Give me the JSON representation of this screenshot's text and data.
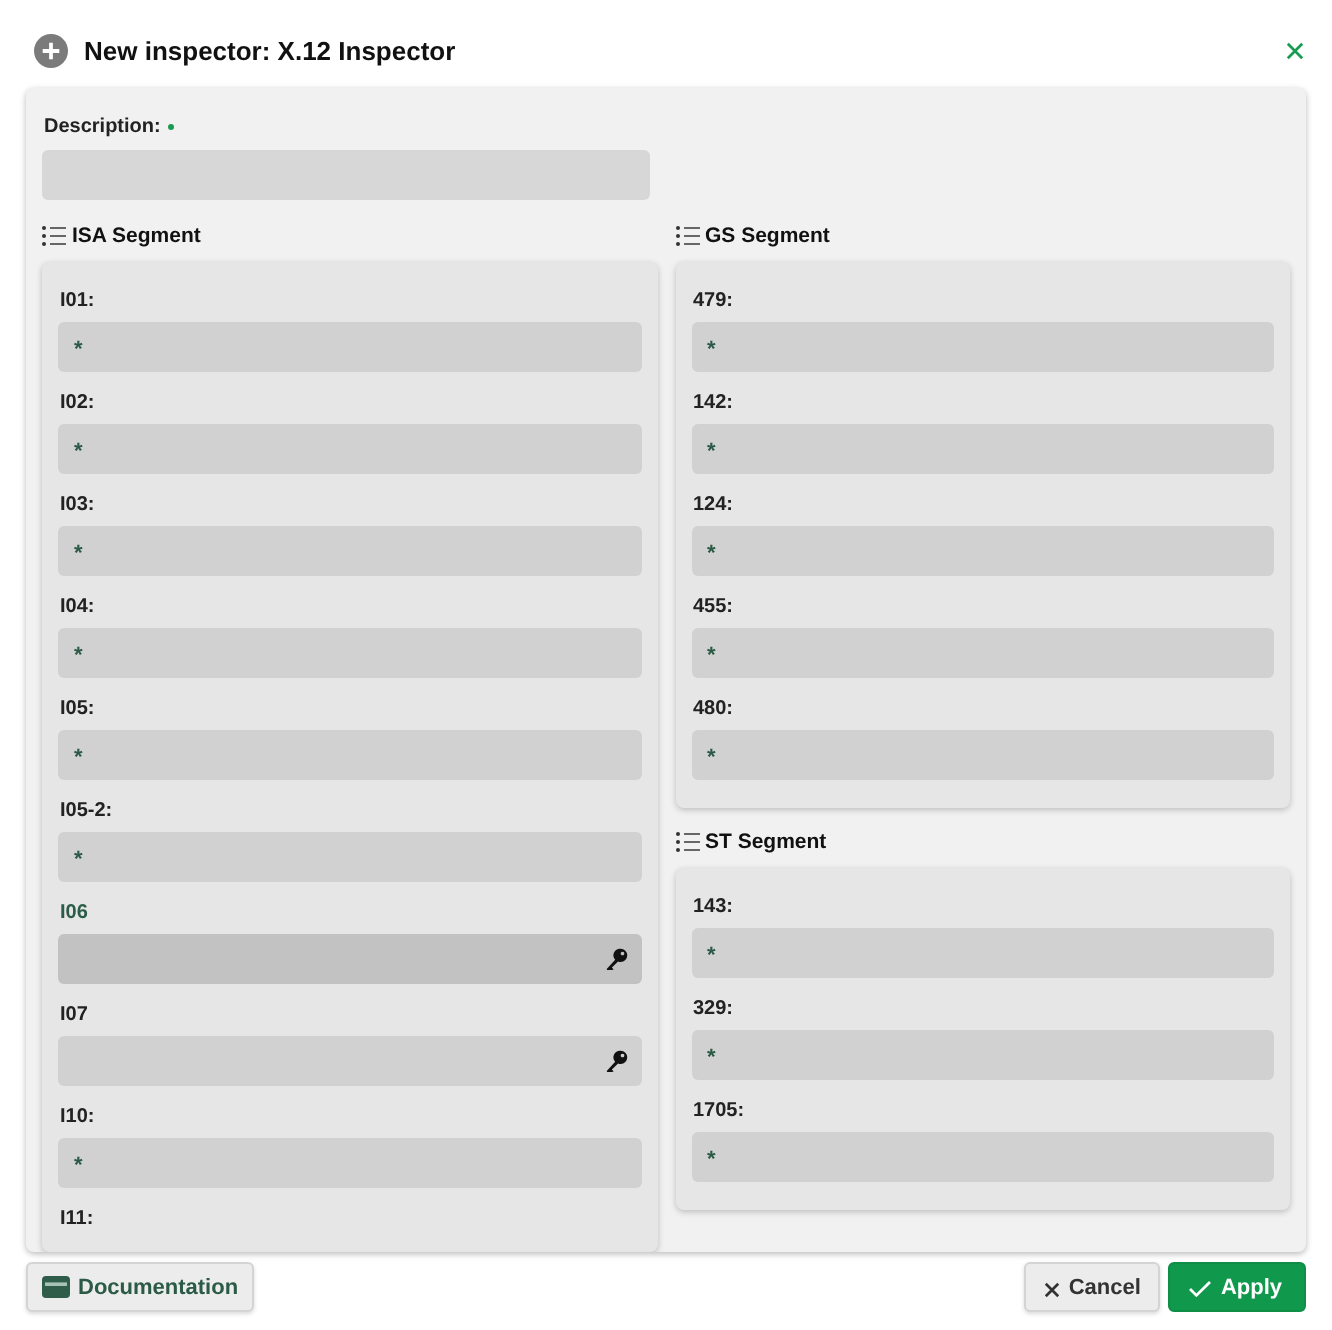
{
  "dialog": {
    "title": "New inspector: X.12 Inspector"
  },
  "description": {
    "label": "Description:",
    "required": true
  },
  "columns": [
    {
      "segments": [
        {
          "title": "ISA Segment",
          "fields": [
            {
              "label": "I01:",
              "kind": "text",
              "value": "*",
              "focused": false
            },
            {
              "label": "I02:",
              "kind": "text",
              "value": "*",
              "focused": false
            },
            {
              "label": "I03:",
              "kind": "text",
              "value": "*",
              "focused": false
            },
            {
              "label": "I04:",
              "kind": "text",
              "value": "*",
              "focused": false
            },
            {
              "label": "I05:",
              "kind": "text",
              "value": "*",
              "focused": false
            },
            {
              "label": "I05-2:",
              "kind": "text",
              "value": "*",
              "focused": false
            },
            {
              "label": "I06",
              "kind": "secret",
              "focused": true
            },
            {
              "label": "I07",
              "kind": "secret",
              "focused": false
            },
            {
              "label": "I10:",
              "kind": "text",
              "value": "*",
              "focused": false
            },
            {
              "label": "I11:",
              "kind": "label",
              "focused": false
            }
          ]
        }
      ]
    },
    {
      "segments": [
        {
          "title": "GS Segment",
          "fields": [
            {
              "label": "479:",
              "kind": "text",
              "value": "*",
              "focused": false
            },
            {
              "label": "142:",
              "kind": "text",
              "value": "*",
              "focused": false
            },
            {
              "label": "124:",
              "kind": "text",
              "value": "*",
              "focused": false
            },
            {
              "label": "455:",
              "kind": "text",
              "value": "*",
              "focused": false
            },
            {
              "label": "480:",
              "kind": "text",
              "value": "*",
              "focused": false
            }
          ]
        },
        {
          "title": "ST Segment",
          "fields": [
            {
              "label": "143:",
              "kind": "text",
              "value": "*",
              "focused": false
            },
            {
              "label": "329:",
              "kind": "text",
              "value": "*",
              "focused": false
            },
            {
              "label": "1705:",
              "kind": "text",
              "value": "*",
              "focused": false
            }
          ]
        }
      ]
    }
  ],
  "footer": {
    "buttons": [
      {
        "label": "Documentation",
        "kind": "documentation"
      },
      {
        "label": "Cancel",
        "kind": "cancel"
      },
      {
        "label": "Apply",
        "kind": "apply"
      }
    ]
  }
}
